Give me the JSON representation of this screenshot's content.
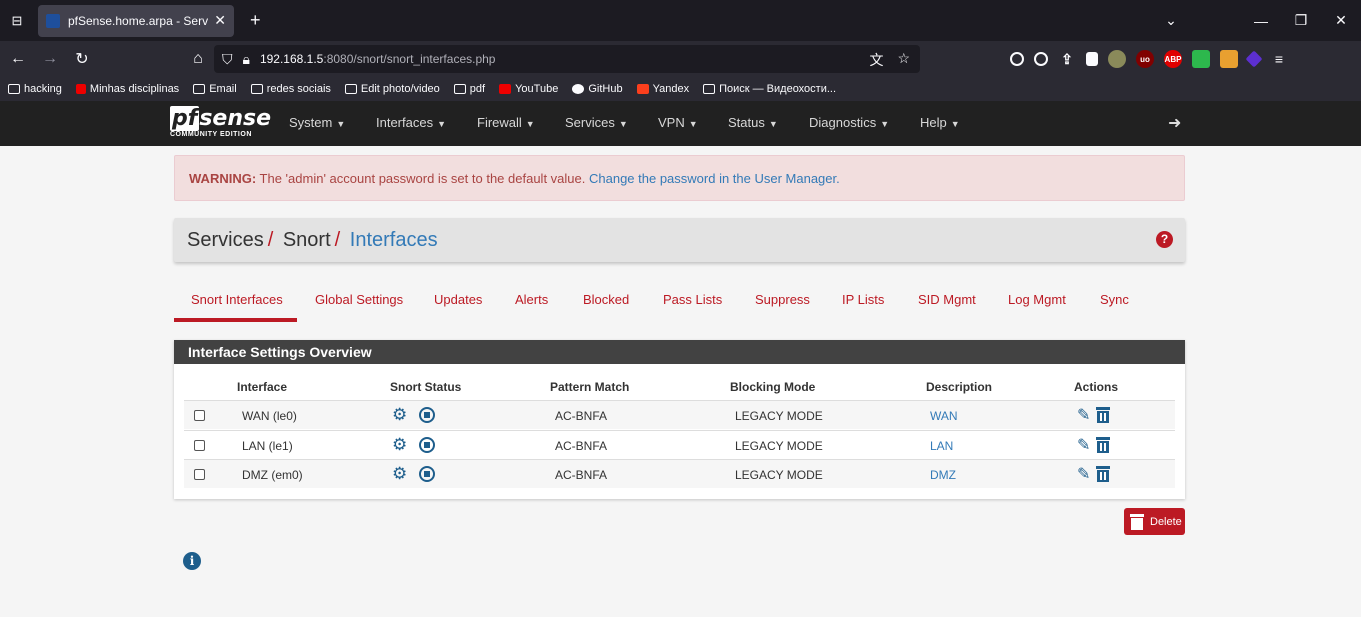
{
  "browser": {
    "tab_title": "pfSense.home.arpa - Services: S",
    "url_host": "192.168.1.5",
    "url_rest": ":8080/snort/snort_interfaces.php",
    "bookmarks": [
      "hacking",
      "Minhas disciplinas",
      "Email",
      "redes sociais",
      "Edit photo/video",
      "pdf",
      "YouTube",
      "GitHub",
      "Yandex",
      "Поиск — Видеохости..."
    ]
  },
  "header": {
    "logo_main": "sense",
    "logo_pf": "pf",
    "logo_sub": "COMMUNITY EDITION",
    "menu": [
      "System",
      "Interfaces",
      "Firewall",
      "Services",
      "VPN",
      "Status",
      "Diagnostics",
      "Help"
    ]
  },
  "warning": {
    "label": "WARNING:",
    "text": " The 'admin' account password is set to the default value. ",
    "link": "Change the password in the User Manager."
  },
  "breadcrumb": {
    "part1": "Services",
    "part2": "Snort",
    "current": "Interfaces"
  },
  "tabs": [
    "Snort Interfaces",
    "Global Settings",
    "Updates",
    "Alerts",
    "Blocked",
    "Pass Lists",
    "Suppress",
    "IP Lists",
    "SID Mgmt",
    "Log Mgmt",
    "Sync"
  ],
  "panel": {
    "title": "Interface Settings Overview",
    "columns": [
      "Interface",
      "Snort Status",
      "Pattern Match",
      "Blocking Mode",
      "Description",
      "Actions"
    ],
    "rows": [
      {
        "interface": "WAN (le0)",
        "pattern": "AC-BNFA",
        "blocking": "LEGACY MODE",
        "description": "WAN"
      },
      {
        "interface": "LAN (le1)",
        "pattern": "AC-BNFA",
        "blocking": "LEGACY MODE",
        "description": "LAN"
      },
      {
        "interface": "DMZ (em0)",
        "pattern": "AC-BNFA",
        "blocking": "LEGACY MODE",
        "description": "DMZ"
      }
    ]
  },
  "delete_label": "Delete",
  "colors": {
    "accent": "#bc1a24",
    "link": "#337ab7",
    "header_bg": "#212121",
    "icon_blue": "#1e5e8c"
  }
}
